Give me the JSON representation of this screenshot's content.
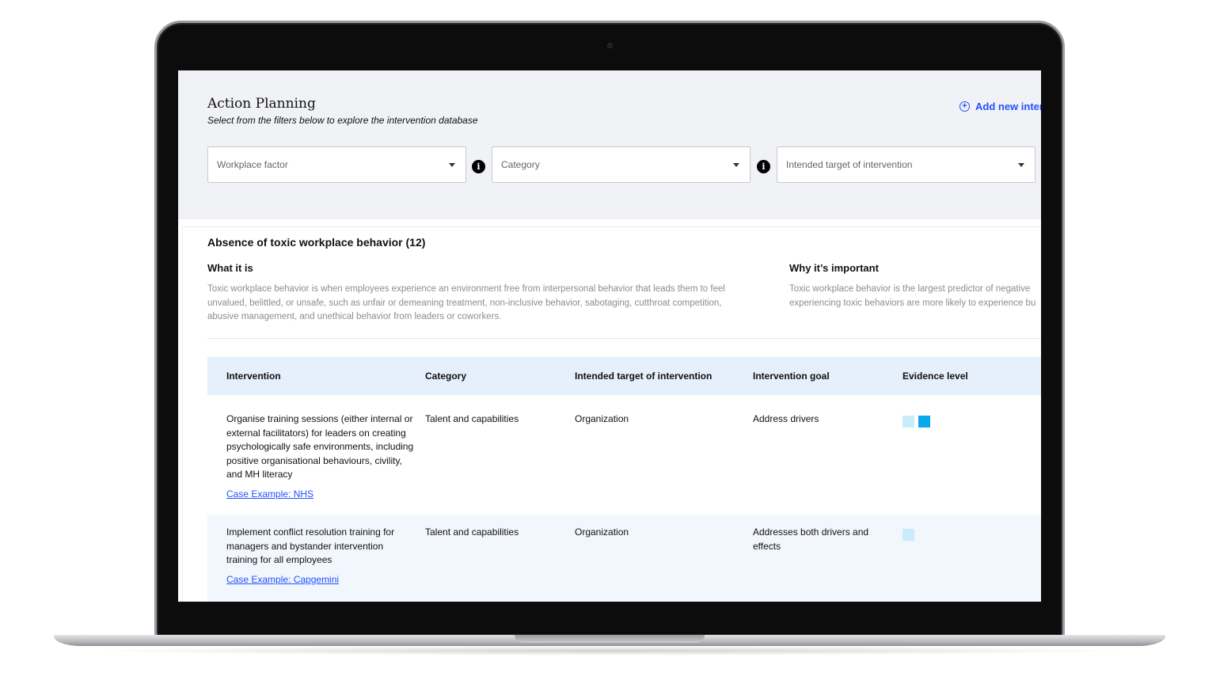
{
  "header": {
    "title": "Action Planning",
    "subtitle": "Select from the filters below to explore the intervention database",
    "add_new_label": "Add new inter"
  },
  "filters": [
    {
      "placeholder": "Workplace factor"
    },
    {
      "placeholder": "Category"
    },
    {
      "placeholder": "Intended target of intervention"
    }
  ],
  "section": {
    "title": "Absence of toxic workplace behavior (12)",
    "what_heading": "What it is",
    "what_text_lines": [
      "Toxic workplace behavior is when employees experience an environment free from interpersonal behavior that leads them to feel",
      "unvalued, belittled, or unsafe, such as unfair or demeaning treatment, non-inclusive behavior, sabotaging, cutthroat competition,",
      "abusive management, and unethical behavior from leaders or coworkers."
    ],
    "why_heading": "Why it’s important",
    "why_text_lines": [
      "Toxic workplace behavior is the largest predictor of negative",
      "experiencing toxic behaviors are more likely to experience bu"
    ]
  },
  "table": {
    "columns": [
      "Intervention",
      "Category",
      "Intended target of intervention",
      "Intervention goal",
      "Evidence level"
    ],
    "rows": [
      {
        "intervention_lines": [
          "Organise training sessions (either internal or",
          "external facilitators) for leaders on creating",
          "psychologically safe environments, including",
          "positive organisational behaviours, civility,",
          "and MH literacy"
        ],
        "case_link": "Case Example: NHS",
        "category": "Talent and capabilities",
        "target": "Organization",
        "goal_lines": [
          "Address drivers"
        ],
        "evidence_level": 2
      },
      {
        "intervention_lines": [
          "Implement conflict resolution training for",
          "managers and bystander intervention",
          "training for all employees"
        ],
        "case_link": "Case Example: Capgemini",
        "category": "Talent and capabilities",
        "target": "Organization",
        "goal_lines": [
          "Addresses both drivers and",
          "effects"
        ],
        "evidence_level": 1
      }
    ]
  },
  "colors": {
    "accent": "#2251ff",
    "evidence_light": "#c9ecfb",
    "evidence_strong": "#0aa6ee",
    "header_bg": "#e6effc"
  }
}
